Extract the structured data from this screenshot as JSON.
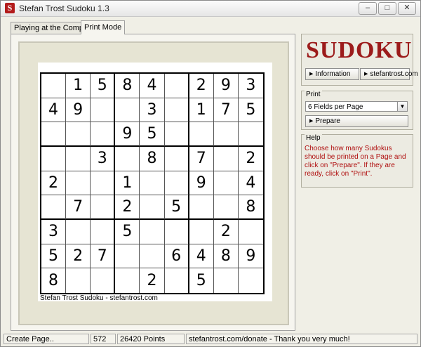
{
  "window": {
    "title": "Stefan Trost Sudoku 1.3",
    "icon_letter": "S",
    "minimize": "–",
    "restore": "□",
    "close": "✕"
  },
  "tabs": [
    {
      "label": "Playing at the Computer"
    },
    {
      "label": "Print Mode",
      "active": true
    }
  ],
  "sudoku": {
    "rows": [
      [
        "",
        "1",
        "5",
        "8",
        "4",
        "",
        "2",
        "9",
        "3"
      ],
      [
        "4",
        "9",
        "",
        "",
        "3",
        "",
        "1",
        "7",
        "5"
      ],
      [
        "",
        "",
        "",
        "9",
        "5",
        "",
        "",
        "",
        ""
      ],
      [
        "",
        "",
        "3",
        "",
        "8",
        "",
        "7",
        "",
        "2"
      ],
      [
        "2",
        "",
        "",
        "1",
        "",
        "",
        "9",
        "",
        "4"
      ],
      [
        "",
        "7",
        "",
        "2",
        "",
        "5",
        "",
        "",
        "8"
      ],
      [
        "3",
        "",
        "",
        "5",
        "",
        "",
        "",
        "2",
        ""
      ],
      [
        "5",
        "2",
        "7",
        "",
        "",
        "6",
        "4",
        "8",
        "9"
      ],
      [
        "8",
        "",
        "",
        "",
        "2",
        "",
        "5",
        "",
        ""
      ]
    ],
    "footer": "Stefan Trost Sudoku - stefantrost.com"
  },
  "side": {
    "logo": "SUDOKU",
    "information_button": "Information",
    "website_button": "stefantrost.com",
    "print_group": "Print",
    "fields_select": "6 Fields per Page",
    "prepare_button": "Prepare",
    "help_group": "Help",
    "help_text": "Choose how many Sudokus should be printed on a Page and click on \"Prepare\". If they are ready, click on \"Print\"."
  },
  "status": {
    "action": "Create Page..",
    "count": "572",
    "points": "26420 Points",
    "donate": "stefantrost.com/donate - Thank you very much!"
  },
  "colors": {
    "accent": "#9c1b1b",
    "help_text": "#b01010"
  }
}
